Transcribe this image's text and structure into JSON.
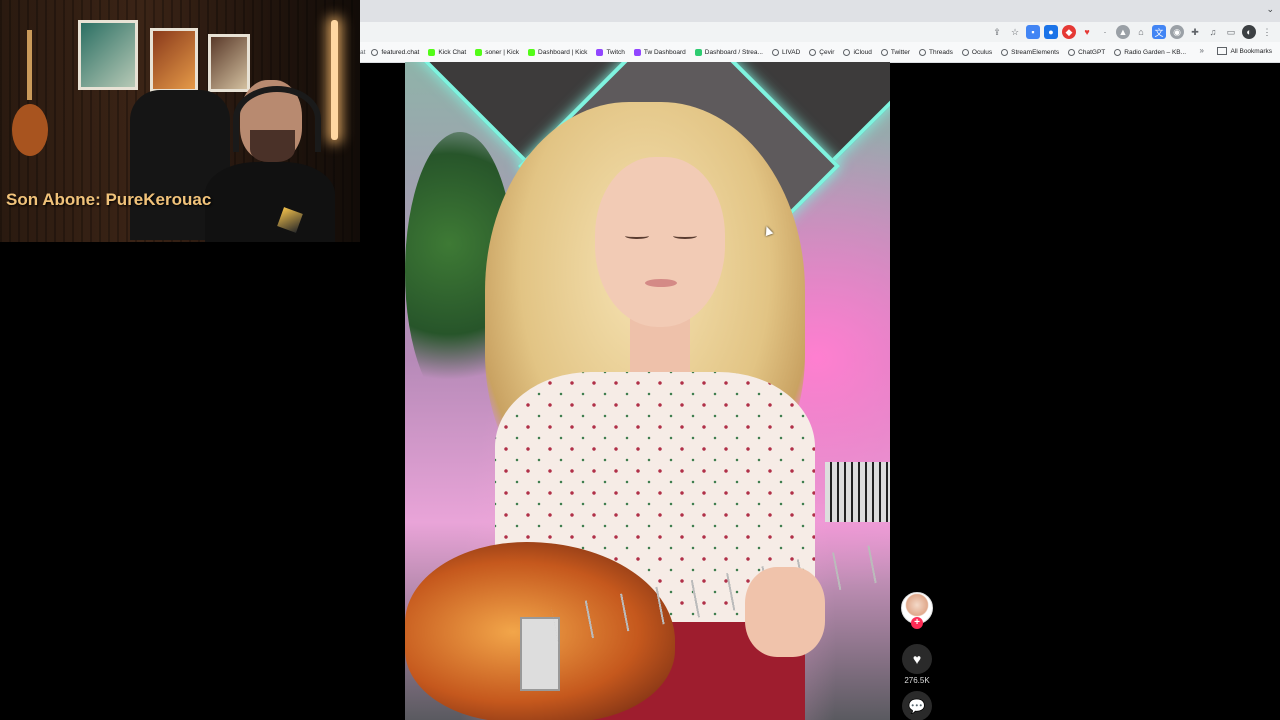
{
  "webcam": {
    "caption": "Son Abone: PureKerouac"
  },
  "browser": {
    "bookmarks": [
      {
        "label": "featured.chat",
        "icon": "globe-icon"
      },
      {
        "label": "Kick Chat",
        "icon": "kick-icon"
      },
      {
        "label": "soner | Kick",
        "icon": "kick-icon"
      },
      {
        "label": "Dashboard | Kick",
        "icon": "kick-icon"
      },
      {
        "label": "Twitch",
        "icon": "twitch-icon"
      },
      {
        "label": "Tw Dashboard",
        "icon": "twitch-icon"
      },
      {
        "label": "Dashboard / Strea...",
        "icon": "streamelements-icon"
      },
      {
        "label": "LIVAD",
        "icon": "globe-icon"
      },
      {
        "label": "Çevir",
        "icon": "globe-icon"
      },
      {
        "label": "iCloud",
        "icon": "apple-icon"
      },
      {
        "label": "Twitter",
        "icon": "globe-icon"
      },
      {
        "label": "Threads",
        "icon": "globe-icon"
      },
      {
        "label": "Oculus",
        "icon": "globe-icon"
      },
      {
        "label": "StreamElements",
        "icon": "globe-icon"
      },
      {
        "label": "ChatGPT",
        "icon": "globe-icon"
      },
      {
        "label": "Radio Garden – KB...",
        "icon": "globe-icon"
      }
    ],
    "bookmarks_edge": "at",
    "all_bookmarks": "All Bookmarks"
  },
  "video": {
    "like_count": "276.5K"
  },
  "colors": {
    "accent_follow": "#fe2c55",
    "caption": "#f0c27a",
    "neon_edge": "#7ff3df"
  }
}
